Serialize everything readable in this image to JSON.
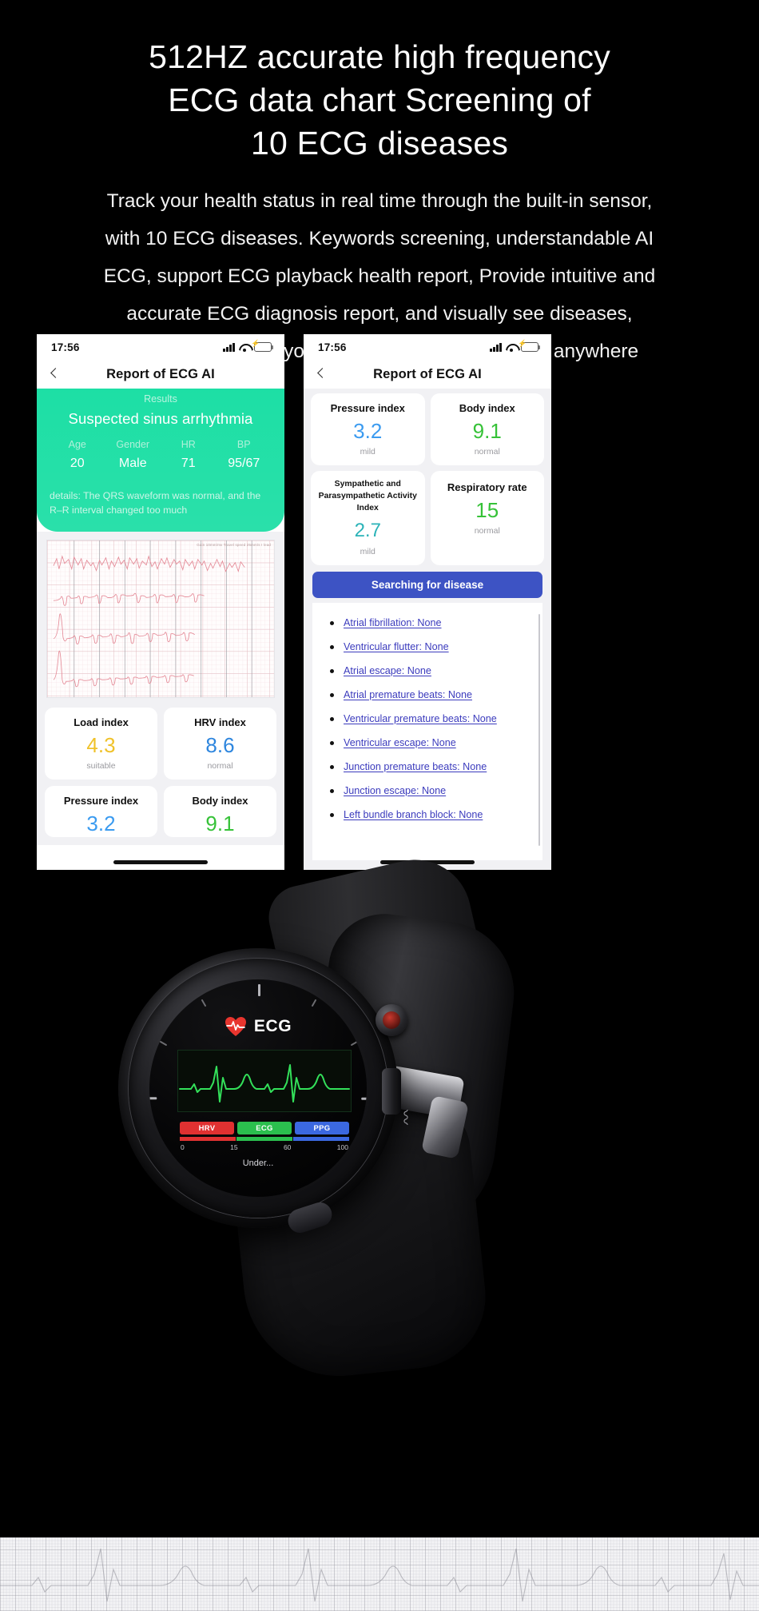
{
  "headline": {
    "line1": "512HZ accurate high frequency",
    "line2": "ECG data chart Screening of",
    "line3": "10 ECG diseases"
  },
  "subcopy": {
    "line1": "Track your health status in real time through the built-in sensor,",
    "line2": "with 10 ECG diseases. Keywords screening, understandable AI",
    "line3": "ECG, support ECG playback health report, Provide intuitive and",
    "line4": "accurate ECG diagnosis report, and visually see diseases,",
    "line5": "potential risks, Let you know your health anytime, anywhere"
  },
  "phone_left": {
    "status": {
      "time": "17:56"
    },
    "nav": {
      "back_icon": "chevron-left-icon",
      "title": "Report of ECG AI"
    },
    "results": {
      "kicker": "Results",
      "diagnosis": "Suspected sinus arrhythmia",
      "vitals": [
        {
          "key": "Age",
          "value": "20"
        },
        {
          "key": "Gender",
          "value": "Male"
        },
        {
          "key": "HR",
          "value": "71"
        },
        {
          "key": "BP",
          "value": "95/67"
        }
      ],
      "details_line1": "details: The QRS waveform was normal, and the",
      "details_line2": "R–R interval changed too much"
    },
    "ecg_chart_label": "Gain 10mm/mv Travel speed 25mm/s  I  lead",
    "cards": [
      {
        "title": "Load index",
        "value": "4.3",
        "status": "suitable",
        "color": "#f0c22a"
      },
      {
        "title": "HRV index",
        "value": "8.6",
        "status": "normal",
        "color": "#2e86de"
      },
      {
        "title": "Pressure index",
        "value": "3.2",
        "status": "",
        "color": "#3b9bf0"
      },
      {
        "title": "Body index",
        "value": "9.1",
        "status": "",
        "color": "#36c238"
      }
    ]
  },
  "phone_right": {
    "status": {
      "time": "17:56"
    },
    "nav": {
      "back_icon": "chevron-left-icon",
      "title": "Report of ECG AI"
    },
    "cards": [
      {
        "title": "Pressure index",
        "value": "3.2",
        "status": "mild",
        "color": "#3b9bf0"
      },
      {
        "title": "Body index",
        "value": "9.1",
        "status": "normal",
        "color": "#36c238"
      },
      {
        "title": "Sympathetic and Parasympathetic Activity Index",
        "value": "2.7",
        "status": "mild",
        "color": "#2bb3b8"
      },
      {
        "title": "Respiratory rate",
        "value": "15",
        "status": "normal",
        "color": "#36c238"
      }
    ],
    "search_button": "Searching for disease",
    "diseases": [
      "Atrial fibrillation: None",
      "Ventricular flutter: None",
      "Atrial escape: None",
      "Atrial premature beats: None",
      "Ventricular premature beats: None",
      "Ventricular escape: None",
      "Junction premature beats: None",
      "Junction escape: None",
      "Left bundle branch block: None"
    ]
  },
  "watch": {
    "face_title": "ECG",
    "heart_icon": "heart-pulse-icon",
    "legend": [
      {
        "label": "HRV",
        "color": "#e03131"
      },
      {
        "label": "ECG",
        "color": "#2bbf4e"
      },
      {
        "label": "PPG",
        "color": "#3b68e0"
      }
    ],
    "scale": [
      "0",
      "15",
      "60",
      "100"
    ],
    "under_text": "Under..."
  },
  "colors": {
    "background": "#000000",
    "results_green": "#2be0ab",
    "search_blue": "#3d53c4",
    "link_blue": "#3b3bbd"
  }
}
